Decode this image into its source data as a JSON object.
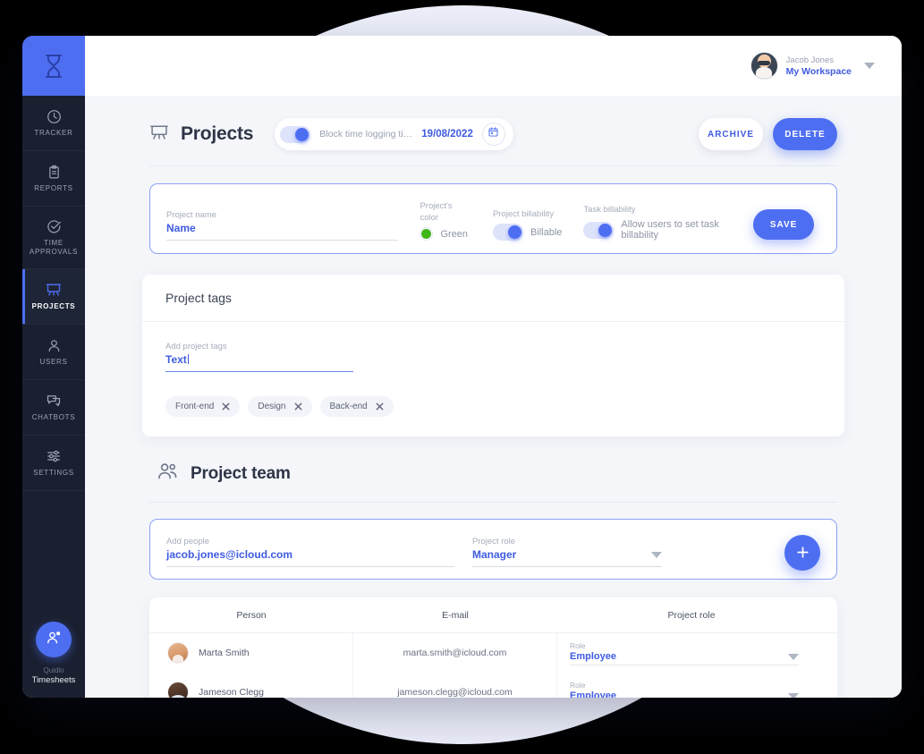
{
  "sidebar": {
    "logo_icon": "hourglass-icon",
    "items": [
      {
        "label": "TRACKER",
        "icon": "clock-icon",
        "active": false
      },
      {
        "label": "REPORTS",
        "icon": "clipboard-icon",
        "active": false
      },
      {
        "label": "TIME\nAPPROVALS",
        "label_line1": "TIME",
        "label_line2": "APPROVALS",
        "icon": "check-circle-icon",
        "active": false
      },
      {
        "label": "PROJECTS",
        "icon": "projector-icon",
        "active": true
      },
      {
        "label": "USERS",
        "icon": "user-icon",
        "active": false
      },
      {
        "label": "CHATBOTS",
        "icon": "chat-bubbles-icon",
        "active": false
      },
      {
        "label": "SETTINGS",
        "icon": "sliders-icon",
        "active": false
      }
    ],
    "footer": {
      "fab_icon": "add-user-icon",
      "brand_line1": "Quidlo",
      "brand_line2": "Timesheets"
    }
  },
  "topbar": {
    "user_name": "Jacob Jones",
    "workspace": "My Workspace",
    "avatar": "user-avatar",
    "chevron": "chevron-down-icon"
  },
  "page": {
    "icon": "projector-icon",
    "title": "Projects",
    "block_time": {
      "toggle_on": true,
      "label": "Block time logging til...",
      "date": "19/08/2022",
      "calendar_icon": "calendar-icon"
    },
    "archive_label": "ARCHIVE",
    "delete_label": "DELETE"
  },
  "project_form": {
    "name_label": "Project name",
    "name_value": "Name",
    "color_label": "Project's color",
    "color_value": "Green",
    "color_hex": "#3fb618",
    "project_billability_label": "Project billability",
    "project_billability_value": "Billable",
    "project_billability_on": true,
    "task_billability_label": "Task billability",
    "task_billability_value": "Allow users to set task billability",
    "task_billability_on": true,
    "save_label": "SAVE"
  },
  "project_tags": {
    "heading": "Project tags",
    "input_label": "Add project tags",
    "input_value": "Text",
    "tags": [
      {
        "label": "Front-end"
      },
      {
        "label": "Design"
      },
      {
        "label": "Back-end"
      }
    ]
  },
  "project_team": {
    "icon": "people-icon",
    "heading": "Project team",
    "add_people_label": "Add people",
    "add_people_value": "jacob.jones@icloud.com",
    "project_role_label": "Project role",
    "project_role_value": "Manager",
    "add_button_icon": "plus-icon",
    "table": {
      "columns": [
        "Person",
        "E-mail",
        "Project role"
      ],
      "rows": [
        {
          "name": "Marta Smith",
          "email": "marta.smith@icloud.com",
          "role_label": "Role",
          "role_value": "Employee",
          "avatar": "marta-avatar"
        },
        {
          "name": "Jameson Clegg",
          "email": "jameson.clegg@icloud.com",
          "role_label": "Role",
          "role_value": "Employee",
          "avatar": "jameson-avatar"
        }
      ]
    }
  },
  "colors": {
    "accent": "#4e6ef2",
    "accent_text": "#3f5be0",
    "sidebar_bg": "#1a2030",
    "content_bg": "#f4f6fa",
    "backdrop": "#eceef9",
    "green": "#3fb618"
  }
}
